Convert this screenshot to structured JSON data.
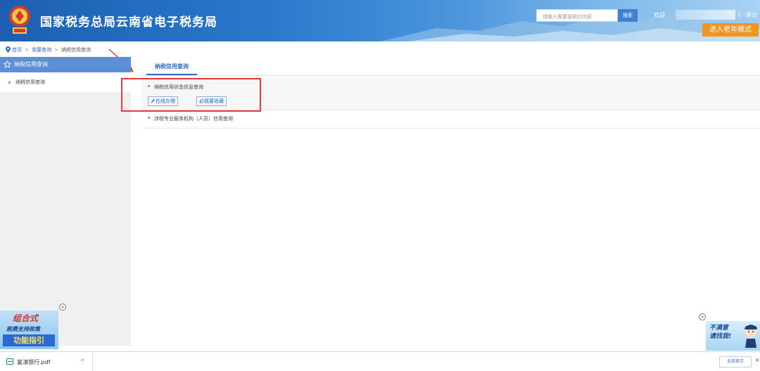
{
  "header": {
    "site_title": "国家税务总局云南省电子税务局",
    "search_placeholder": "请输入需要搜索的内容",
    "search_button": "搜索",
    "welcome": "欢迎",
    "logout": "退出",
    "separator": "|",
    "elder_mode": "进入老年模式"
  },
  "breadcrumb": {
    "home": "首页",
    "level1": "我要查询",
    "level2": "纳税信用查询",
    "sep": ">"
  },
  "sidebar": {
    "head": "纳税信用查询",
    "items": [
      {
        "label": "纳税信用查询"
      }
    ]
  },
  "main": {
    "tab": "纳税信用查询",
    "items": [
      {
        "title": "纳税信用状态信息查询",
        "actions": [
          "在线办理",
          "我要收藏"
        ]
      },
      {
        "title": "涉税专业服务机构（人员）信用查询"
      }
    ]
  },
  "ads": {
    "left": {
      "line1": "组合式",
      "line2": "税费支持政策",
      "line3": "功能指引"
    },
    "right": {
      "text": "不满意\n请找我!"
    },
    "close_glyph": "×"
  },
  "download_bar": {
    "file_name": "富滇银行.pdf",
    "chevron": "^",
    "show_all": "全部显示",
    "close": "×"
  },
  "colors": {
    "accent": "#2f6dc4",
    "sidebar_head": "#5b8fd6",
    "highlight": "#e63b3b",
    "elder_button": "#f0961f"
  }
}
